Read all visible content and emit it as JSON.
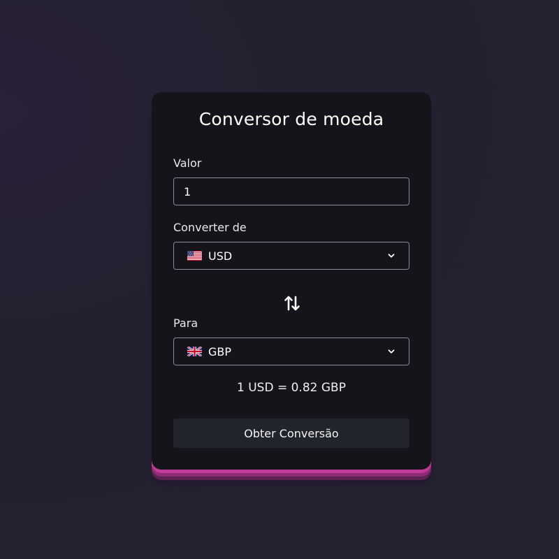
{
  "converter": {
    "title": "Conversor de moeda",
    "amount_label": "Valor",
    "amount_value": "1",
    "from_label": "Converter de",
    "from_currency": "USD",
    "from_flag_icon": "us-flag-icon",
    "to_label": "Para",
    "to_currency": "GBP",
    "to_flag_icon": "uk-flag-icon",
    "swap_icon": "swap-arrows-icon",
    "result_text": "1 USD = 0.82 GBP",
    "submit_label": "Obter Conversão"
  },
  "colors": {
    "background": "#232230",
    "card": "#15141b",
    "accent": "#c23a9a",
    "button": "#22242b",
    "border": "#8a8a94"
  }
}
